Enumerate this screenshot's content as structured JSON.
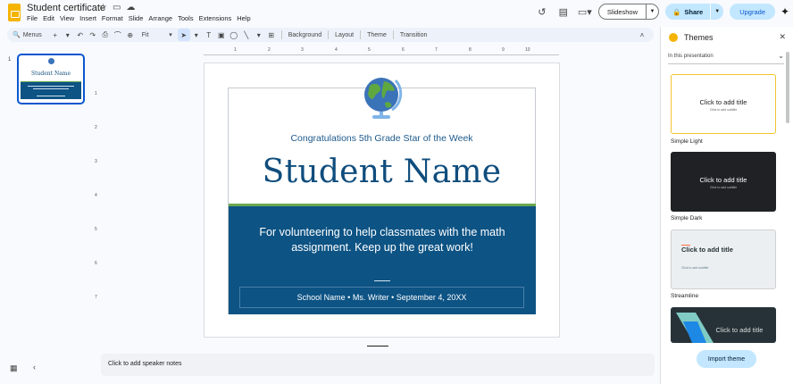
{
  "app": {
    "doc_title": "Student certificate",
    "menu": [
      "File",
      "Edit",
      "View",
      "Insert",
      "Format",
      "Slide",
      "Arrange",
      "Tools",
      "Extensions",
      "Help"
    ]
  },
  "header": {
    "slideshow": "Slideshow",
    "share": "Share",
    "upgrade": "Upgrade"
  },
  "toolbar": {
    "menus": "Menus",
    "zoom": "Fit",
    "background": "Background",
    "layout": "Layout",
    "theme": "Theme",
    "transition": "Transition"
  },
  "filmstrip": {
    "slide_number": "1",
    "thumb_name": "Student Name"
  },
  "ruler": {
    "h_marks": [
      "1",
      "2",
      "3",
      "4",
      "5",
      "6",
      "7",
      "8",
      "9",
      "10"
    ],
    "v_marks": [
      "1",
      "2",
      "3",
      "4",
      "5",
      "6",
      "7"
    ]
  },
  "slide": {
    "subtitle": "Congratulations 5th Grade Star of the Week",
    "name": "Student Name",
    "message": "For volunteering to help classmates with the math assignment. Keep up the great work!",
    "footer": "School Name • Ms. Writer • September 4, 20XX"
  },
  "notes": {
    "placeholder": "Click to add speaker notes"
  },
  "themes_panel": {
    "title": "Themes",
    "filter": "In this presentation",
    "themes": [
      {
        "name": "Simple Light",
        "title": "Click to add title",
        "subtitle": "Click to add subtitle"
      },
      {
        "name": "Simple Dark",
        "title": "Click to add title",
        "subtitle": "Click to add subtitle"
      },
      {
        "name": "Streamline",
        "title": "Click to add title",
        "subtitle": "Click to add subtitle"
      },
      {
        "name": "",
        "title": "Click to add title",
        "subtitle": ""
      }
    ],
    "import_button": "Import theme"
  },
  "colors": {
    "accent": "#0b57d0",
    "slide_blue": "#0d5384",
    "slide_green": "#6aa84f",
    "name_blue": "#0f4d7d",
    "share_bg": "#c2e7ff"
  }
}
